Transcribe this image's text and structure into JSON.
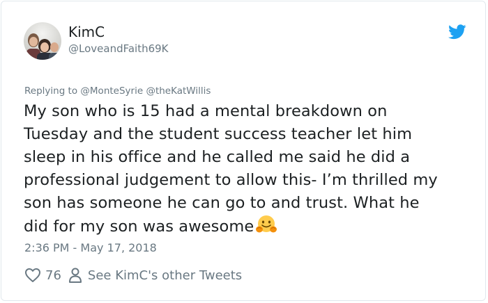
{
  "author": {
    "name": "KimC",
    "handle": "@LoveandFaith69K"
  },
  "reply": {
    "prefix": "Replying to",
    "mentions": [
      "@MonteSyrie",
      "@theKatWillis"
    ]
  },
  "tweet": {
    "lines": [
      "My son who is 15 had a mental breakdown on",
      "Tuesday and the student success teacher let him",
      "sleep in his office and he called me said he did a",
      "professional judgement to allow this- I’m thrilled my",
      "son has someone he can go to and trust.  What he",
      "did for my son was awesome"
    ],
    "emoji": "hugging-face-emoji"
  },
  "timestamp": "2:36 PM - May 17, 2018",
  "actions": {
    "likes": "76",
    "other_tweets": "See KimC's other Tweets"
  },
  "colors": {
    "twitter_blue": "#1da1f2",
    "text": "#1c2022",
    "muted": "#697882",
    "border": "#e1e8ed"
  }
}
